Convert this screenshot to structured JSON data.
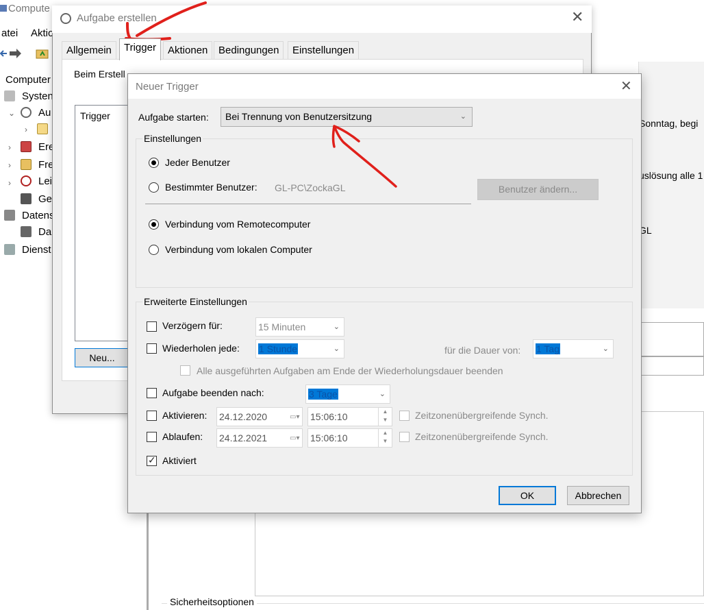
{
  "background": {
    "title": "Compute",
    "menu": [
      "atei",
      "Aktio"
    ],
    "tree": [
      {
        "label": "Computer",
        "indent": 0
      },
      {
        "label": "Systen",
        "indent": 1
      },
      {
        "label": "Au",
        "indent": 2
      },
      {
        "label": "",
        "indent": 3
      },
      {
        "label": "Ere",
        "indent": 2
      },
      {
        "label": "Fre",
        "indent": 2
      },
      {
        "label": "Lei",
        "indent": 2
      },
      {
        "label": "Ge",
        "indent": 2
      },
      {
        "label": "Datens",
        "indent": 1
      },
      {
        "label": "Da",
        "indent": 2
      },
      {
        "label": "Dienst",
        "indent": 1
      }
    ],
    "right_column": [
      "Sonntag, begi",
      "uslösung alle 1",
      "GL"
    ],
    "security_label": "Sicherheitsoptionen"
  },
  "task_dialog": {
    "title": "Aufgabe erstellen",
    "tabs": [
      "Allgemein",
      "Trigger",
      "Aktionen",
      "Bedingungen",
      "Einstellungen"
    ],
    "active_tab": "Trigger",
    "description": "Beim Erstellen einer Aufgabe können Sie die Bedingungen angeben, unter denen die Aufgabe ausgelöst wird.",
    "description_visible": "Beim Erstell",
    "list_header": "Trigger",
    "new_button": "Neu..."
  },
  "trigger_dialog": {
    "title": "Neuer Trigger",
    "start_label": "Aufgabe starten:",
    "start_value": "Bei Trennung von Benutzersitzung",
    "settings": {
      "group_label": "Einstellungen",
      "any_user": "Jeder Benutzer",
      "specific_user": "Bestimmter Benutzer:",
      "user_name": "GL-PC\\ZockaGL",
      "change_user_button": "Benutzer ändern...",
      "remote": "Verbindung vom Remotecomputer",
      "local": "Verbindung vom lokalen Computer",
      "selected_user_option": "any",
      "selected_connection_option": "remote"
    },
    "advanced": {
      "group_label": "Erweiterte Einstellungen",
      "delay_label": "Verzögern für:",
      "delay_value": "15 Minuten",
      "repeat_label": "Wiederholen jede:",
      "repeat_value": "1 Stunde",
      "duration_label": "für die Dauer von:",
      "duration_value": "1 Tag",
      "stop_all_label": "Alle ausgeführten Aufgaben am Ende der Wiederholungsdauer beenden",
      "stop_after_label": "Aufgabe beenden nach:",
      "stop_after_value": "3 Tage",
      "activate_label": "Aktivieren:",
      "activate_date": "24.12.2020",
      "activate_time": "15:06:10",
      "expire_label": "Ablaufen:",
      "expire_date": "24.12.2021",
      "expire_time": "15:06:10",
      "sync_label": "Zeitzonenübergreifende Synch.",
      "enabled_label": "Aktiviert",
      "enabled": true
    },
    "ok_button": "OK",
    "cancel_button": "Abbrechen"
  },
  "colors": {
    "annotation": "#e0201b",
    "accent": "#0078d7"
  }
}
